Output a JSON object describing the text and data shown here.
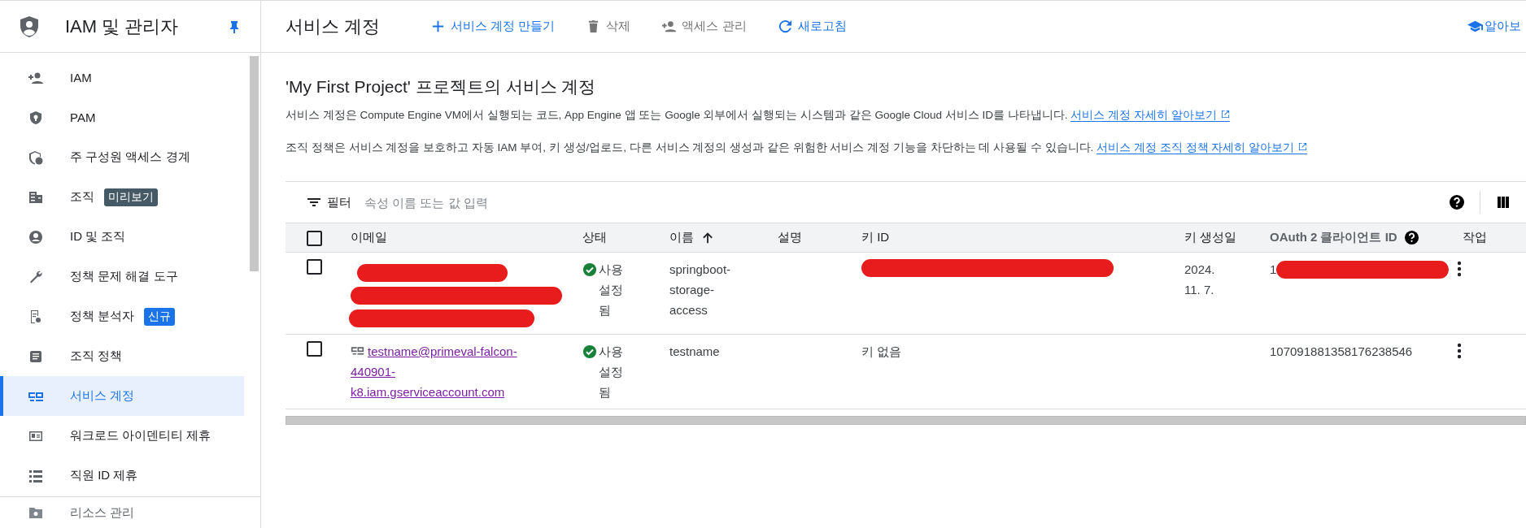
{
  "sidebar": {
    "title": "IAM 및 관리자",
    "pinned": true,
    "items": [
      {
        "label": "IAM",
        "selected": false
      },
      {
        "label": "PAM",
        "selected": false
      },
      {
        "label": "주 구성원 액세스 경계",
        "selected": false
      },
      {
        "label": "조직",
        "selected": false,
        "badge": {
          "text": "미리보기",
          "color": "#455a64"
        }
      },
      {
        "label": "ID 및 조직",
        "selected": false
      },
      {
        "label": "정책 문제 해결 도구",
        "selected": false
      },
      {
        "label": "정책 분석자",
        "selected": false,
        "badge": {
          "text": "신규",
          "color": "#1a73e8"
        }
      },
      {
        "label": "조직 정책",
        "selected": false
      },
      {
        "label": "서비스 계정",
        "selected": true
      },
      {
        "label": "워크로드 아이덴티티 제휴",
        "selected": false
      },
      {
        "label": "직원 ID 제휴",
        "selected": false
      }
    ],
    "footer_item": {
      "label": "리소스 관리"
    }
  },
  "header": {
    "title": "서비스 계정",
    "actions": [
      {
        "label": "서비스 계정 만들기",
        "kind": "create",
        "disabled": false
      },
      {
        "label": "삭제",
        "kind": "delete",
        "disabled": true
      },
      {
        "label": "액세스 관리",
        "kind": "access",
        "disabled": true
      },
      {
        "label": "새로고침",
        "kind": "refresh",
        "disabled": false
      }
    ],
    "learn": "알아보"
  },
  "page": {
    "heading": "'My First Project' 프로젝트의 서비스 계정",
    "paragraphs": [
      {
        "text": "서비스 계정은 Compute Engine VM에서 실행되는 코드, App Engine 앱 또는 Google 외부에서 실행되는 시스템과 같은 Google Cloud 서비스 ID를 나타냅니다.",
        "link": "서비스 계정 자세히 알아보기"
      },
      {
        "text": "조직 정책은 서비스 계정을 보호하고 자동 IAM 부여, 키 생성/업로드, 다른 서비스 계정의 생성과 같은 위험한 서비스 계정 기능을 차단하는 데 사용될 수 있습니다.",
        "link": "서비스 계정 조직 정책 자세히 알아보기"
      }
    ]
  },
  "table": {
    "filter": {
      "label": "필터",
      "placeholder": "속성 이름 또는 값 입력"
    },
    "header_checked": false,
    "columns": [
      {
        "label": "이메일",
        "sorted": false,
        "help": false
      },
      {
        "label": "상태",
        "sorted": false,
        "help": false
      },
      {
        "label": "이름",
        "sorted": true,
        "help": false
      },
      {
        "label": "설명",
        "sorted": false,
        "help": false
      },
      {
        "label": "키 ID",
        "sorted": false,
        "help": false
      },
      {
        "label": "키 생성일",
        "sorted": false,
        "help": false
      },
      {
        "label": "OAuth 2 클라이언트 ID",
        "sorted": false,
        "help": true
      },
      {
        "label": "작업",
        "sorted": false,
        "help": false
      }
    ],
    "rows": [
      {
        "checked": false,
        "email_redacted": true,
        "status": "사용 설정됨",
        "enabled": true,
        "name": "springboot-storage-access",
        "key_id_redacted": true,
        "key_created": "2024. 11. 7.",
        "oauth_id": "1",
        "oauth_redacted": true
      },
      {
        "checked": false,
        "email": "testname@primeval-falcon-440901-k8.iam.gserviceaccount.com",
        "email_redacted": false,
        "status": "사용 설정됨",
        "enabled": true,
        "name": "testname",
        "key_id": "키 없음",
        "key_id_redacted": false,
        "oauth_id": "107091881358176238546",
        "oauth_redacted": false
      }
    ]
  }
}
